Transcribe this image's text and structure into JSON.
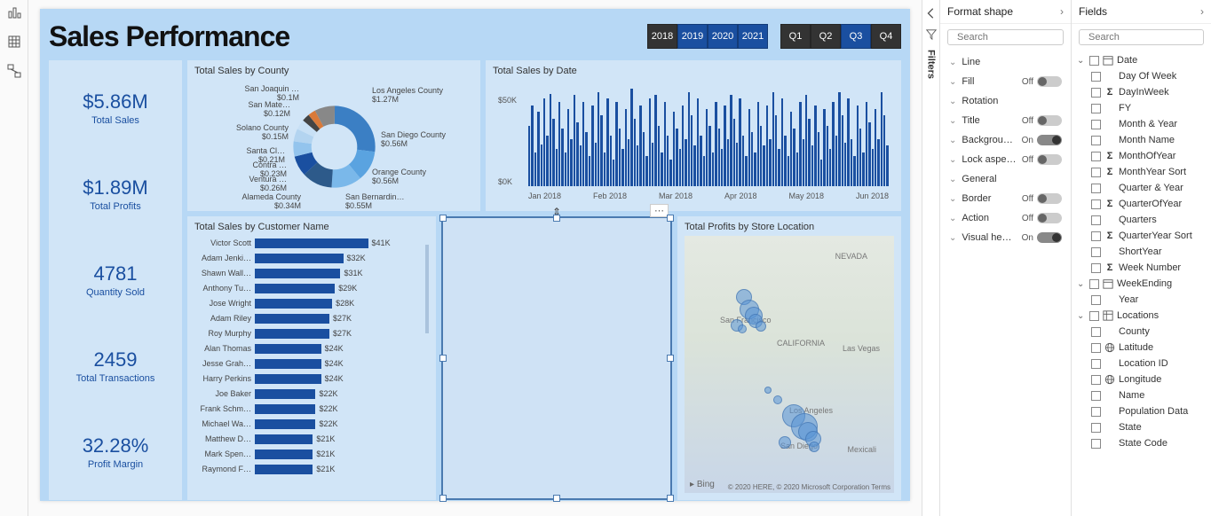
{
  "left_rail": {
    "icons": [
      "bar-chart-icon",
      "table-icon",
      "model-icon"
    ]
  },
  "page_title": "Sales Performance",
  "years": [
    "2018",
    "2019",
    "2020",
    "2021"
  ],
  "year_active_index": 0,
  "quarters": [
    "Q1",
    "Q2",
    "Q3",
    "Q4"
  ],
  "quarter_active_index": 2,
  "kpis": [
    {
      "value": "$5.86M",
      "label": "Total Sales"
    },
    {
      "value": "$1.89M",
      "label": "Total Profits"
    },
    {
      "value": "4781",
      "label": "Quantity Sold"
    },
    {
      "value": "2459",
      "label": "Total Transactions"
    },
    {
      "value": "32.28%",
      "label": "Profit Margin"
    }
  ],
  "donut_title": "Total Sales by County",
  "date_title": "Total Sales by Date",
  "customer_title": "Total Sales by Customer Name",
  "map_title": "Total Profits by Store Location",
  "map_labels": [
    "NEVADA",
    "San Francisco",
    "CALIFORNIA",
    "Las Vegas",
    "Los Angeles",
    "San Diego",
    "Mexicali"
  ],
  "map_attr_bing": "Bing",
  "map_attr_text": "© 2020 HERE, © 2020 Microsoft Corporation Terms",
  "filters_label": "Filters",
  "format_pane": {
    "title": "Format shape",
    "search_placeholder": "Search",
    "items": [
      {
        "label": "Line",
        "toggle": null
      },
      {
        "label": "Fill",
        "toggle": "Off"
      },
      {
        "label": "Rotation",
        "toggle": null
      },
      {
        "label": "Title",
        "toggle": "Off"
      },
      {
        "label": "Backgrou…",
        "toggle": "On"
      },
      {
        "label": "Lock aspe…",
        "toggle": "Off"
      },
      {
        "label": "General",
        "toggle": null
      },
      {
        "label": "Border",
        "toggle": "Off"
      },
      {
        "label": "Action",
        "toggle": "Off"
      },
      {
        "label": "Visual he…",
        "toggle": "On"
      }
    ]
  },
  "fields_pane": {
    "title": "Fields",
    "search_placeholder": "Search",
    "groups": [
      {
        "expanded": true,
        "name": "Date",
        "icon": "calendar",
        "children": [
          {
            "name": "Day Of Week",
            "icon": ""
          },
          {
            "name": "DayInWeek",
            "icon": "sigma"
          },
          {
            "name": "FY",
            "icon": ""
          },
          {
            "name": "Month & Year",
            "icon": ""
          },
          {
            "name": "Month Name",
            "icon": ""
          },
          {
            "name": "MonthOfYear",
            "icon": "sigma"
          },
          {
            "name": "MonthYear Sort",
            "icon": "sigma"
          },
          {
            "name": "Quarter & Year",
            "icon": ""
          },
          {
            "name": "QuarterOfYear",
            "icon": "sigma"
          },
          {
            "name": "Quarters",
            "icon": ""
          },
          {
            "name": "QuarterYear Sort",
            "icon": "sigma"
          },
          {
            "name": "ShortYear",
            "icon": ""
          },
          {
            "name": "Week Number",
            "icon": "sigma"
          }
        ]
      },
      {
        "expanded": true,
        "name": "WeekEnding",
        "icon": "calendar",
        "children": [
          {
            "name": "Year",
            "icon": ""
          }
        ]
      },
      {
        "expanded": true,
        "name": "Locations",
        "icon": "table",
        "children": [
          {
            "name": "County",
            "icon": ""
          },
          {
            "name": "Latitude",
            "icon": "globe"
          },
          {
            "name": "Location ID",
            "icon": ""
          },
          {
            "name": "Longitude",
            "icon": "globe"
          },
          {
            "name": "Name",
            "icon": ""
          },
          {
            "name": "Population Data",
            "icon": ""
          },
          {
            "name": "State",
            "icon": ""
          },
          {
            "name": "State Code",
            "icon": ""
          }
        ]
      }
    ]
  },
  "chart_data": {
    "donut": {
      "type": "pie",
      "title": "Total Sales by County",
      "series": [
        {
          "name": "Los Angeles County",
          "value": 1.27
        },
        {
          "name": "San Diego County",
          "value": 0.56
        },
        {
          "name": "Orange County",
          "value": 0.56
        },
        {
          "name": "San Bernardin…",
          "value": 0.55
        },
        {
          "name": "Alameda County",
          "value": 0.34
        },
        {
          "name": "Ventura …",
          "value": 0.26
        },
        {
          "name": "Contra …",
          "value": 0.23
        },
        {
          "name": "Santa Cl…",
          "value": 0.21
        },
        {
          "name": "Solano County",
          "value": 0.15
        },
        {
          "name": "San Mate…",
          "value": 0.12
        },
        {
          "name": "San Joaquin …",
          "value": 0.1
        }
      ],
      "value_prefix": "$",
      "value_suffix": "M"
    },
    "columns": {
      "type": "bar",
      "title": "Total Sales by Date",
      "ylabel": "",
      "ylim": [
        0,
        60000
      ],
      "yticks": [
        "$0K",
        "$50K"
      ],
      "xticks": [
        "Jan 2018",
        "Feb 2018",
        "Mar 2018",
        "Apr 2018",
        "May 2018",
        "Jun 2018"
      ],
      "values": [
        36,
        48,
        20,
        44,
        25,
        52,
        30,
        55,
        40,
        22,
        50,
        34,
        20,
        46,
        28,
        54,
        38,
        24,
        50,
        32,
        18,
        48,
        26,
        56,
        42,
        20,
        52,
        30,
        16,
        50,
        34,
        22,
        46,
        28,
        58,
        40,
        24,
        48,
        32,
        18,
        52,
        26,
        54,
        36,
        20,
        50,
        30,
        16,
        44,
        34,
        22,
        48,
        28,
        56,
        42,
        24,
        52,
        30,
        18,
        46,
        36,
        20,
        50,
        34,
        22,
        48,
        28,
        54,
        40,
        26,
        52,
        30,
        18,
        46,
        32,
        20,
        50,
        36,
        24,
        48,
        28,
        56,
        42,
        22,
        52,
        30,
        18,
        44,
        34,
        20,
        50,
        28,
        54,
        40,
        24,
        48,
        32,
        16,
        46,
        36,
        22,
        50,
        30,
        56,
        42,
        26,
        52,
        28,
        18,
        48,
        34,
        20,
        50,
        38,
        22,
        46,
        28,
        56,
        42,
        24
      ]
    },
    "bars": {
      "type": "bar",
      "title": "Total Sales by Customer Name",
      "categories": [
        "Victor Scott",
        "Adam Jenki…",
        "Shawn Wall…",
        "Anthony Tu…",
        "Jose Wright",
        "Adam Riley",
        "Roy Murphy",
        "Alan Thomas",
        "Jesse Grah…",
        "Harry Perkins",
        "Joe Baker",
        "Frank Schm…",
        "Michael Wa…",
        "Matthew D…",
        "Mark Spen…",
        "Raymond F…"
      ],
      "values": [
        41,
        32,
        31,
        29,
        28,
        27,
        27,
        24,
        24,
        24,
        22,
        22,
        22,
        21,
        21,
        21
      ],
      "value_prefix": "$",
      "value_suffix": "K",
      "xlim": [
        0,
        45
      ]
    }
  }
}
